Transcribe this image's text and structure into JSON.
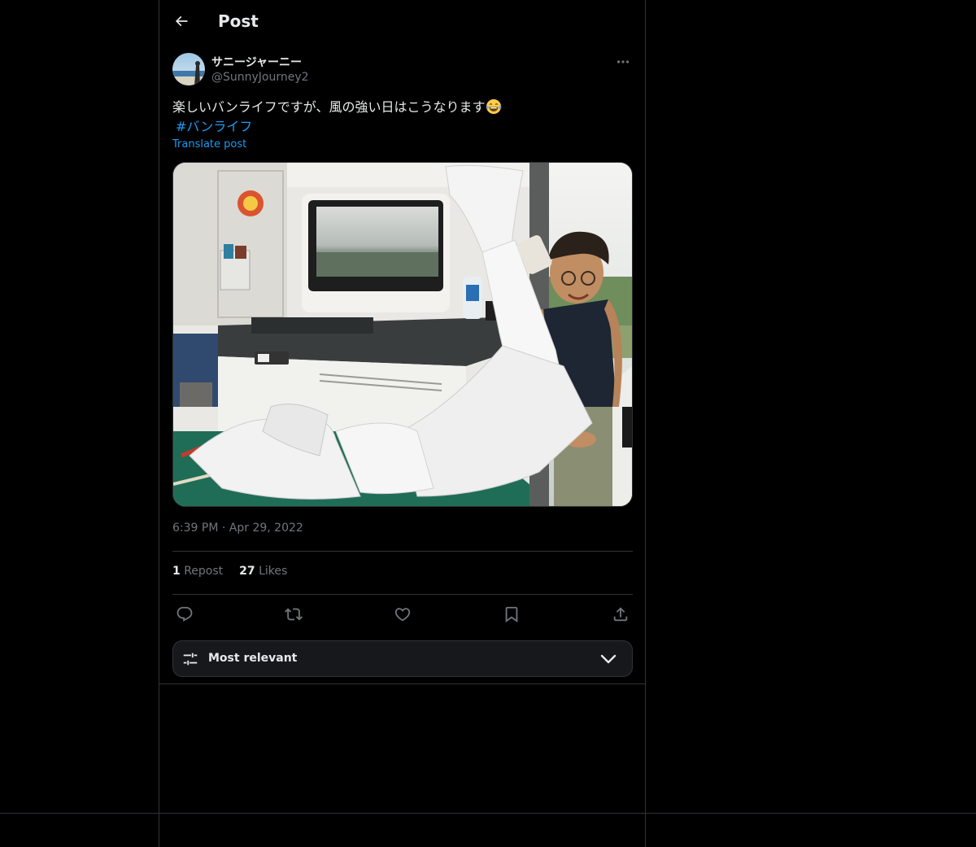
{
  "header": {
    "title": "Post"
  },
  "author": {
    "display_name": "サニージャーニー",
    "handle": "@SunnyJourney2"
  },
  "post": {
    "text": "楽しいバンライフですが、風の強い日はこうなります",
    "hashtag": "#バンライフ",
    "translate_label": "Translate post",
    "time": "6:39 PM",
    "separator": "·",
    "date": "Apr 29, 2022"
  },
  "stats": {
    "reposts_count": "1",
    "reposts_label": "Repost",
    "likes_count": "27",
    "likes_label": "Likes"
  },
  "actions": [
    "reply-icon",
    "repost-icon",
    "like-icon",
    "bookmark-icon",
    "share-icon"
  ],
  "sort": {
    "label": "Most relevant"
  },
  "colors": {
    "background": "#000000",
    "border": "#2f3336",
    "text_primary": "#e7e9ea",
    "text_secondary": "#71767b",
    "accent": "#1d9bf0",
    "sort_bar_bg": "#16181c"
  }
}
